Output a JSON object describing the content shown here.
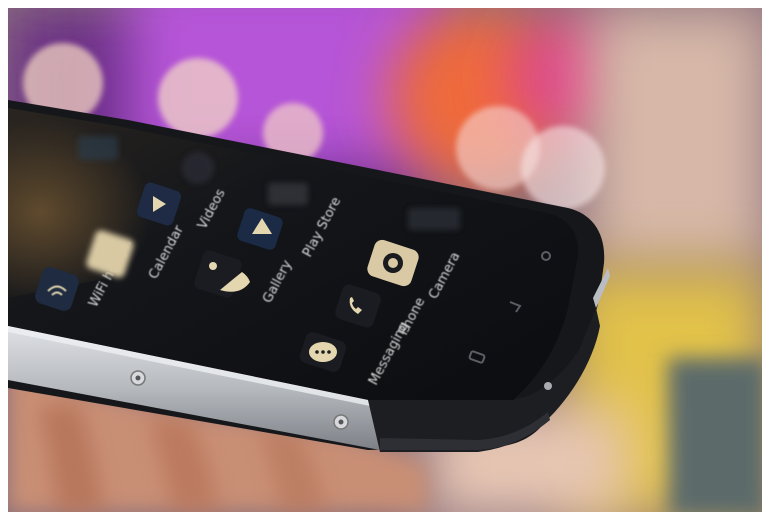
{
  "photo": {
    "subject": "smartphone",
    "colors": {
      "bokeh_purple": "#9b4fd6",
      "bokeh_orange": "#f06a3a",
      "bokeh_pink": "#e04a8a",
      "background_yellow": "#e9c94a",
      "phone_frame_silver": "#b9bcc2",
      "phone_bumper": "#1c1d20",
      "screen": "#101216",
      "skin": "#d9a38b"
    }
  },
  "screen": {
    "apps": [
      {
        "id": "wifi-hotspot",
        "label": "WiFi hotsp..",
        "icon": "wifi-hotspot-icon"
      },
      {
        "id": "calendar",
        "label": "Calendar",
        "icon": "calendar-icon"
      },
      {
        "id": "videos",
        "label": "Videos",
        "icon": "videos-icon"
      },
      {
        "id": "gallery",
        "label": "Gallery",
        "icon": "gallery-icon"
      },
      {
        "id": "play-store",
        "label": "Play Store",
        "icon": "play-store-icon"
      },
      {
        "id": "camera",
        "label": "Camera",
        "icon": "camera-icon"
      },
      {
        "id": "phone",
        "label": "Phone",
        "icon": "phone-icon"
      },
      {
        "id": "messaging",
        "label": "Messaging",
        "icon": "messaging-icon"
      }
    ]
  }
}
